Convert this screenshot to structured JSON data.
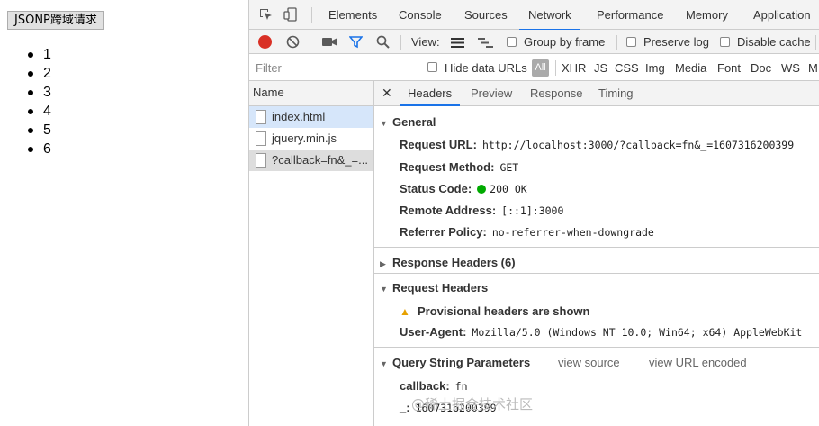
{
  "page": {
    "button_label": "JSONP跨域请求",
    "list": [
      "1",
      "2",
      "3",
      "4",
      "5",
      "6"
    ]
  },
  "devtools": {
    "tabs": [
      "Elements",
      "Console",
      "Sources",
      "Network",
      "Performance",
      "Memory",
      "Application"
    ],
    "active_tab": "Network",
    "toolbar": {
      "view_label": "View:",
      "group_by_frame": "Group by frame",
      "preserve_log": "Preserve log",
      "disable_cache": "Disable cache"
    },
    "filter": {
      "placeholder": "Filter",
      "hide_data_urls": "Hide data URLs",
      "all": "All",
      "types": [
        "XHR",
        "JS",
        "CSS",
        "Img",
        "Media",
        "Font",
        "Doc",
        "WS",
        "M"
      ]
    },
    "name_column": {
      "header": "Name",
      "rows": [
        "index.html",
        "jquery.min.js",
        "?callback=fn&_=..."
      ]
    },
    "detail_tabs": [
      "Headers",
      "Preview",
      "Response",
      "Timing"
    ],
    "general": {
      "title": "General",
      "request_url_k": "Request URL:",
      "request_url_v": "http://localhost:3000/?callback=fn&_=1607316200399",
      "method_k": "Request Method:",
      "method_v": "GET",
      "status_k": "Status Code:",
      "status_v": "200 OK",
      "remote_k": "Remote Address:",
      "remote_v": "[::1]:3000",
      "referrer_k": "Referrer Policy:",
      "referrer_v": "no-referrer-when-downgrade"
    },
    "response_headers": {
      "title": "Response Headers (6)"
    },
    "request_headers": {
      "title": "Request Headers",
      "warning": "Provisional headers are shown",
      "ua_k": "User-Agent:",
      "ua_v": "Mozilla/5.0 (Windows NT 10.0; Win64; x64) AppleWebKit"
    },
    "query_string": {
      "title": "Query String Parameters",
      "view_source": "view source",
      "view_url_encoded": "view URL encoded",
      "callback_k": "callback:",
      "callback_v": "fn",
      "underscore_k": "_:",
      "underscore_v": "1607316200399"
    },
    "watermark": "@稀土掘金技术社区",
    "colors": {
      "accent": "#1a73e8",
      "record": "#d93025",
      "filter_icon": "#1a73e8",
      "status_ok": "#00aa00"
    }
  }
}
